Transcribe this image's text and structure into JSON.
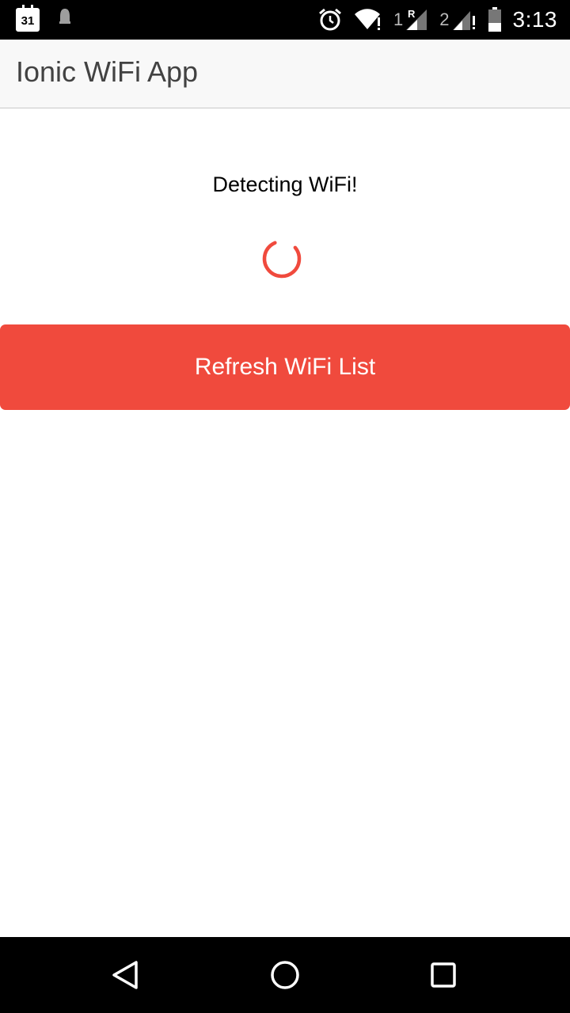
{
  "status_bar": {
    "calendar_day": "31",
    "sim1_label": "1",
    "sim1_roaming": "R",
    "sim2_label": "2",
    "time": "3:13",
    "icons": [
      "calendar-icon",
      "notification-bell-icon",
      "alarm-clock-icon",
      "wifi-icon",
      "signal-sim1-icon",
      "signal-sim2-icon",
      "battery-icon"
    ]
  },
  "toolbar": {
    "title": "Ionic WiFi App"
  },
  "main": {
    "status_text": "Detecting WiFi!",
    "refresh_button_label": "Refresh WiFi List"
  },
  "nav_bar": {
    "icons": [
      "back-icon",
      "home-icon",
      "recent-apps-icon"
    ]
  },
  "colors": {
    "accent": "#f04a3d",
    "toolbar_bg": "#f8f8f8",
    "status_bar_bg": "#000000"
  }
}
